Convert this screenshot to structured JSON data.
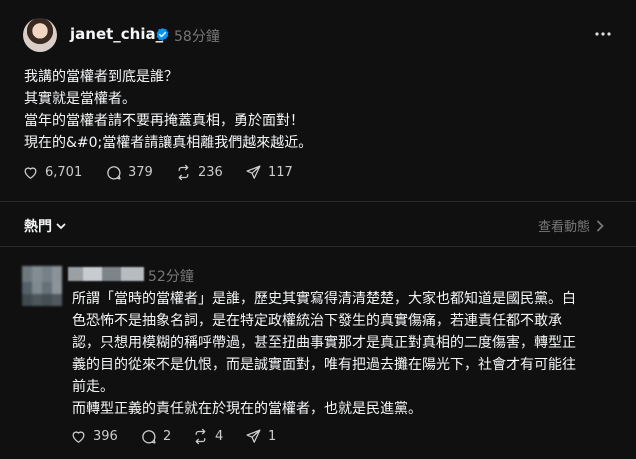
{
  "post": {
    "username": "janet_chia_",
    "time": "58分鐘",
    "lines": [
      "我講的當權者到底是誰？",
      "其實就是當權者。",
      "當年的當權者請不要再掩蓋真相，勇於面對！",
      "現在的&#0;當權者請讓真相離我們越來越近。"
    ],
    "likes": "6,701",
    "comments": "379",
    "reposts": "236",
    "shares": "117"
  },
  "replies_bar": {
    "sort_label": "熱門",
    "activity_label": "查看動態"
  },
  "comment": {
    "time": "52分鐘",
    "lines": [
      "所謂「當時的當權者」是誰，歷史其實寫得清清楚楚，大家也都知道是國民黨。白",
      "色恐怖不是抽象名詞，是在特定政權統治下發生的真實傷痛，若連責任都不敢承",
      "認，只想用模糊的稱呼帶過，甚至扭曲事實那才是真正對真相的二度傷害，轉型正",
      "義的目的從來不是仇恨，而是誠實面對，唯有把過去攤在陽光下，社會才有可能往",
      "前走。",
      "而轉型正義的責任就在於現在的當權者，也就是民進黨。"
    ],
    "likes": "396",
    "comments": "2",
    "reposts": "4",
    "shares": "1"
  },
  "colors": {
    "background": "#101010",
    "text": "#f3f5f7",
    "muted": "#777777",
    "verified": "#0095f6"
  }
}
